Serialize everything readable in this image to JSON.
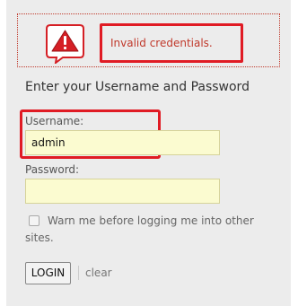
{
  "error": {
    "message": "Invalid credentials.",
    "icon": "warning-icon",
    "accent_color": "#e01b24"
  },
  "form": {
    "heading": "Enter your Username and Password",
    "username_label": "Username:",
    "username_value": "admin",
    "password_label": "Password:",
    "password_value": "",
    "warn_label": "Warn me before logging me into other sites.",
    "warn_checked": false,
    "login_label": "LOGIN",
    "clear_label": "clear"
  }
}
